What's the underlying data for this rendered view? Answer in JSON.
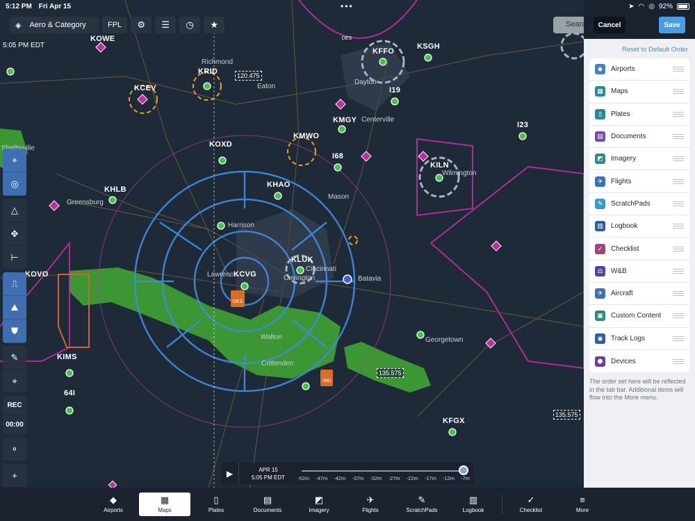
{
  "status_bar": {
    "time": "5:12 PM",
    "date": "Fri Apr 15",
    "battery": "92%"
  },
  "toolbar": {
    "layer_label": "Aero & Category",
    "fpl_label": "FPL",
    "search_placeholder": "Search"
  },
  "map": {
    "time_stamp": "5:05 PM EDT",
    "airports": [
      {
        "id": "KCVG"
      },
      {
        "id": "KLUK"
      },
      {
        "id": "KHAO"
      },
      {
        "id": "KILN"
      },
      {
        "id": "KFFO"
      },
      {
        "id": "KSGH"
      },
      {
        "id": "KRID"
      },
      {
        "id": "KCEV"
      },
      {
        "id": "KMGY"
      },
      {
        "id": "KMWO"
      },
      {
        "id": "KOXD"
      },
      {
        "id": "KHLB"
      },
      {
        "id": "KOVO"
      },
      {
        "id": "KIMS"
      },
      {
        "id": "KFGX"
      },
      {
        "id": "I19"
      },
      {
        "id": "I68"
      },
      {
        "id": "I23"
      },
      {
        "id": "64I"
      },
      {
        "id": "KOWE"
      }
    ],
    "cities": [
      "Richmond",
      "Dayton",
      "Eaton",
      "Centerville",
      "Mason",
      "Greensburg",
      "Harrison",
      "Lawrence",
      "Covington",
      "Cincinnati",
      "Batavia",
      "Walton",
      "Crittenden",
      "Georgetown",
      "Wilmington",
      "Shelbyville"
    ],
    "frequencies": [
      "120.475",
      "135.575",
      "135.575"
    ],
    "markers": [
      "DES",
      "DES",
      "080"
    ]
  },
  "left_tools": {
    "rec_label": "REC",
    "timer": "00:00"
  },
  "timeline": {
    "date": "APR 15",
    "time": "5:05 PM EDT",
    "ticks": [
      "-52m",
      "-47m",
      "-42m",
      "-37m",
      "-32m",
      "-27m",
      "-22m",
      "-17m",
      "-12m",
      "-7m"
    ]
  },
  "panel": {
    "cancel_label": "Cancel",
    "save_label": "Save",
    "reset_label": "Reset to Default Order",
    "items": [
      {
        "label": "Airports",
        "icon": "airport-icon",
        "color": "#4c7fb8"
      },
      {
        "label": "Maps",
        "icon": "map-icon",
        "color": "#2c8a97"
      },
      {
        "label": "Plates",
        "icon": "plate-icon",
        "color": "#2c8a97"
      },
      {
        "label": "Documents",
        "icon": "document-icon",
        "color": "#7b4aa6"
      },
      {
        "label": "Imagery",
        "icon": "imagery-icon",
        "color": "#2c8a97"
      },
      {
        "label": "Flights",
        "icon": "flight-icon",
        "color": "#3e72b0"
      },
      {
        "label": "ScratchPads",
        "icon": "pen-icon",
        "color": "#3e9ac0"
      },
      {
        "label": "Logbook",
        "icon": "book-icon",
        "color": "#2e5e9e"
      },
      {
        "label": "Checklist",
        "icon": "check-icon",
        "color": "#a0467a"
      },
      {
        "label": "W&B",
        "icon": "weight-icon",
        "color": "#4b47a8"
      },
      {
        "label": "Aircraft",
        "icon": "aircraft-icon",
        "color": "#3e72b0"
      },
      {
        "label": "Custom Content",
        "icon": "custom-content-icon",
        "color": "#2f8a7a"
      },
      {
        "label": "Track Logs",
        "icon": "track-icon",
        "color": "#2e5e9e"
      },
      {
        "label": "Devices",
        "icon": "device-icon",
        "color": "#6a3fa0"
      }
    ],
    "note": "The order set here will be reflected in the tab bar. Additional items will flow into the More menu."
  },
  "tabbar": {
    "tabs": [
      {
        "label": "Airports",
        "icon": "airport-icon"
      },
      {
        "label": "Maps",
        "icon": "map-icon",
        "active": true
      },
      {
        "label": "Plates",
        "icon": "plate-icon"
      },
      {
        "label": "Documents",
        "icon": "document-icon"
      },
      {
        "label": "Imagery",
        "icon": "imagery-icon"
      },
      {
        "label": "Flights",
        "icon": "flight-icon"
      },
      {
        "label": "ScratchPads",
        "icon": "pen-icon"
      },
      {
        "label": "Logbook",
        "icon": "book-icon"
      },
      {
        "label": "Checklist",
        "icon": "check-icon"
      },
      {
        "label": "More",
        "icon": "menu-icon"
      }
    ]
  }
}
